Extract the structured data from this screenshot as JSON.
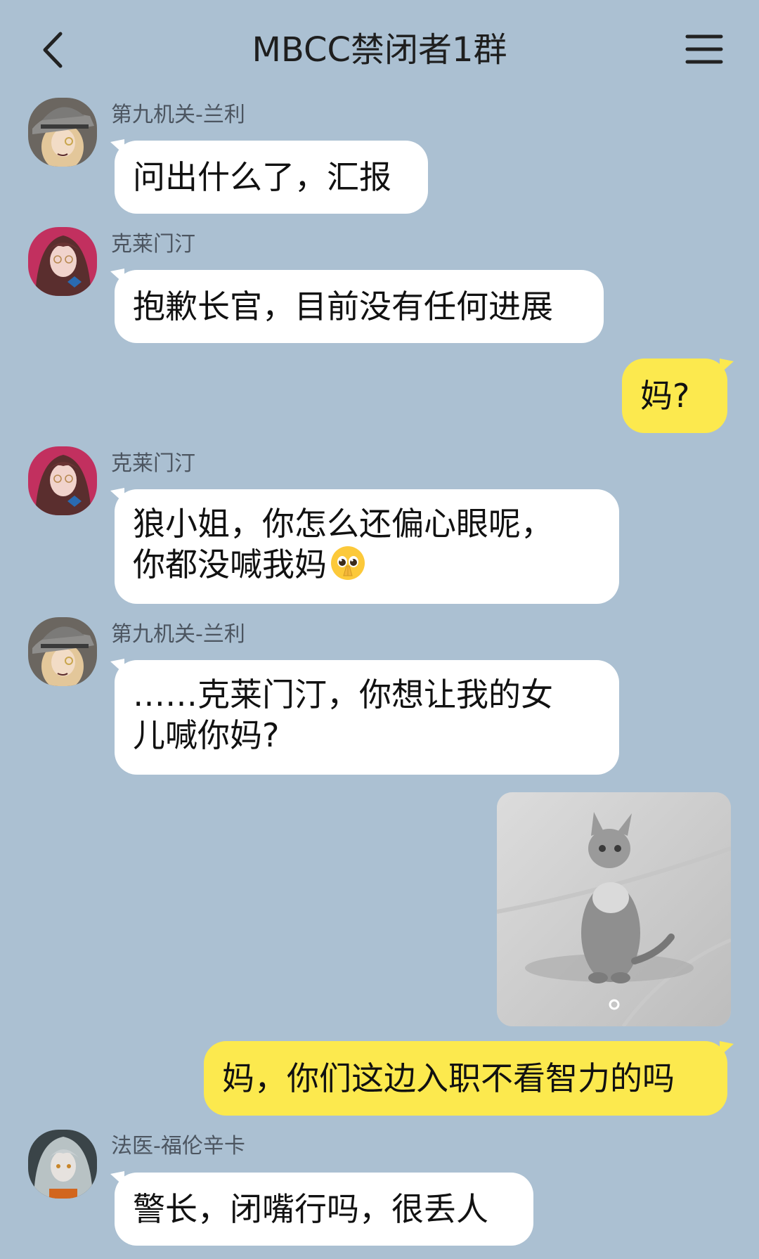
{
  "header": {
    "title": "MBCC禁闭者1群"
  },
  "messages": [
    {
      "sender": "第九机关-兰利",
      "text": "问出什么了，汇报"
    },
    {
      "sender": "克莱门汀",
      "text": "抱歉长官，目前没有任何进展"
    },
    {
      "text": "妈?"
    },
    {
      "sender": "克莱门汀",
      "line1": "狼小姐，你怎么还偏心眼呢，",
      "line2": "你都没喊我妈"
    },
    {
      "sender": "第九机关-兰利",
      "line1": "……克莱门汀，你想让我的女",
      "line2": "儿喊你妈?"
    },
    {
      "image": "gray-kitten-photo"
    },
    {
      "text": "妈，你们这边入职不看智力的吗"
    },
    {
      "sender": "法医-福伦辛卡",
      "text": "警长，闭嘴行吗，很丢人"
    }
  ],
  "colors": {
    "background": "#abc0d2",
    "incoming_bubble": "#ffffff",
    "outgoing_bubble": "#fce94e"
  },
  "icons": [
    "back-arrow-icon",
    "menu-icon",
    "pleading-face-icon"
  ]
}
